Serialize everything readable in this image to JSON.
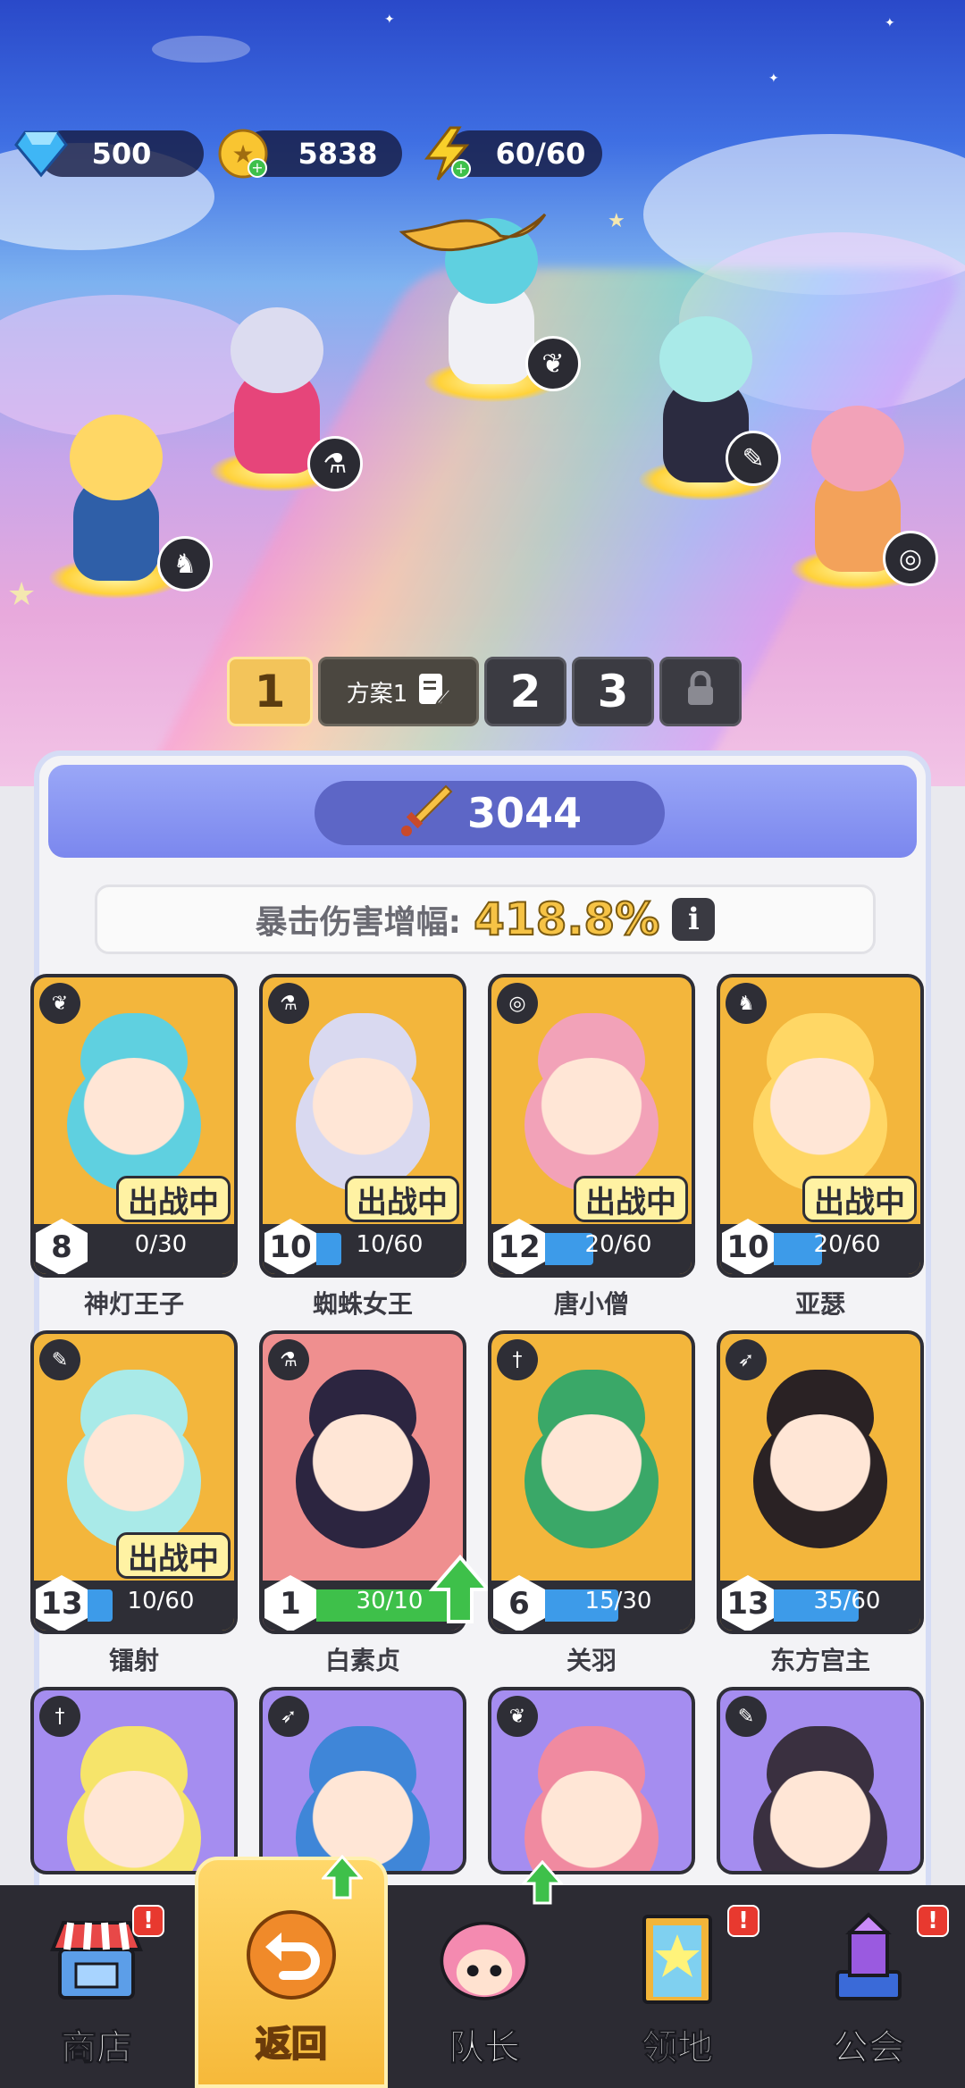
{
  "resources": {
    "gems": "500",
    "gold": "5838",
    "energy": "60/60"
  },
  "formation": {
    "active_tab": "1",
    "plan_name": "方案1",
    "tab2": "2",
    "tab3": "3",
    "tab4_locked": true
  },
  "power": {
    "value": "3044"
  },
  "crit": {
    "label": "暴击伤害增幅:",
    "value": "418.8%",
    "info": "i"
  },
  "deployed_label": "出战中",
  "cards": [
    {
      "name": "神灯王子",
      "level": "8",
      "progress": "0/30",
      "fill": 0.0,
      "deployed": true,
      "class_icon": "wings-icon",
      "color": "#f3b63c",
      "hair": "#5fd0e0"
    },
    {
      "name": "蜘蛛女王",
      "level": "10",
      "progress": "10/60",
      "fill": 0.17,
      "deployed": true,
      "class_icon": "potion-icon",
      "color": "#f3b63c",
      "hair": "#d9d9f0"
    },
    {
      "name": "唐小僧",
      "level": "12",
      "progress": "20/60",
      "fill": 0.33,
      "deployed": true,
      "class_icon": "vortex-icon",
      "color": "#f3b63c",
      "hair": "#f2a2b8"
    },
    {
      "name": "亚瑟",
      "level": "10",
      "progress": "20/60",
      "fill": 0.33,
      "deployed": true,
      "class_icon": "horned-helmet-icon",
      "color": "#f3b63c",
      "hair": "#ffd765"
    },
    {
      "name": "镭射",
      "level": "13",
      "progress": "10/60",
      "fill": 0.17,
      "deployed": true,
      "class_icon": "staff-icon",
      "color": "#f3b63c",
      "hair": "#a9eae8"
    },
    {
      "name": "白素贞",
      "level": "1",
      "progress": "30/10",
      "fill": 1.0,
      "deployed": false,
      "class_icon": "potion-icon",
      "color": "#ef8f8f",
      "hair": "#2c2540",
      "upgrade": true
    },
    {
      "name": "关羽",
      "level": "6",
      "progress": "15/30",
      "fill": 0.5,
      "deployed": false,
      "class_icon": "sword-icon",
      "color": "#f3b63c",
      "hair": "#3aa868"
    },
    {
      "name": "东方宫主",
      "level": "13",
      "progress": "35/60",
      "fill": 0.58,
      "deployed": false,
      "class_icon": "bow-icon",
      "color": "#f3b63c",
      "hair": "#2a2224"
    },
    {
      "name": "",
      "class_icon": "sword-icon",
      "color": "#a58df0",
      "hair": "#f6e46a"
    },
    {
      "name": "",
      "class_icon": "bow-icon",
      "color": "#a58df0",
      "hair": "#3f86d8"
    },
    {
      "name": "",
      "class_icon": "wings-icon",
      "color": "#a58df0",
      "hair": "#f08aa0"
    },
    {
      "name": "",
      "class_icon": "staff-icon",
      "color": "#a58df0",
      "hair": "#3a3040"
    }
  ],
  "nav": [
    {
      "label": "商店",
      "icon": "shop-icon",
      "badge": "!"
    },
    {
      "label": "返回",
      "icon": "return-icon",
      "active": true,
      "upgrade": true
    },
    {
      "label": "队长",
      "icon": "captain-icon",
      "upgrade": true
    },
    {
      "label": "领地",
      "icon": "territory-icon",
      "badge": "!"
    },
    {
      "label": "公会",
      "icon": "guild-icon",
      "badge": "!"
    }
  ],
  "colors": {
    "gold_accent": "#f3c45a",
    "progress_blue": "#3d9be9",
    "progress_green": "#3ec04a",
    "nav_bg": "#2c2b33"
  }
}
